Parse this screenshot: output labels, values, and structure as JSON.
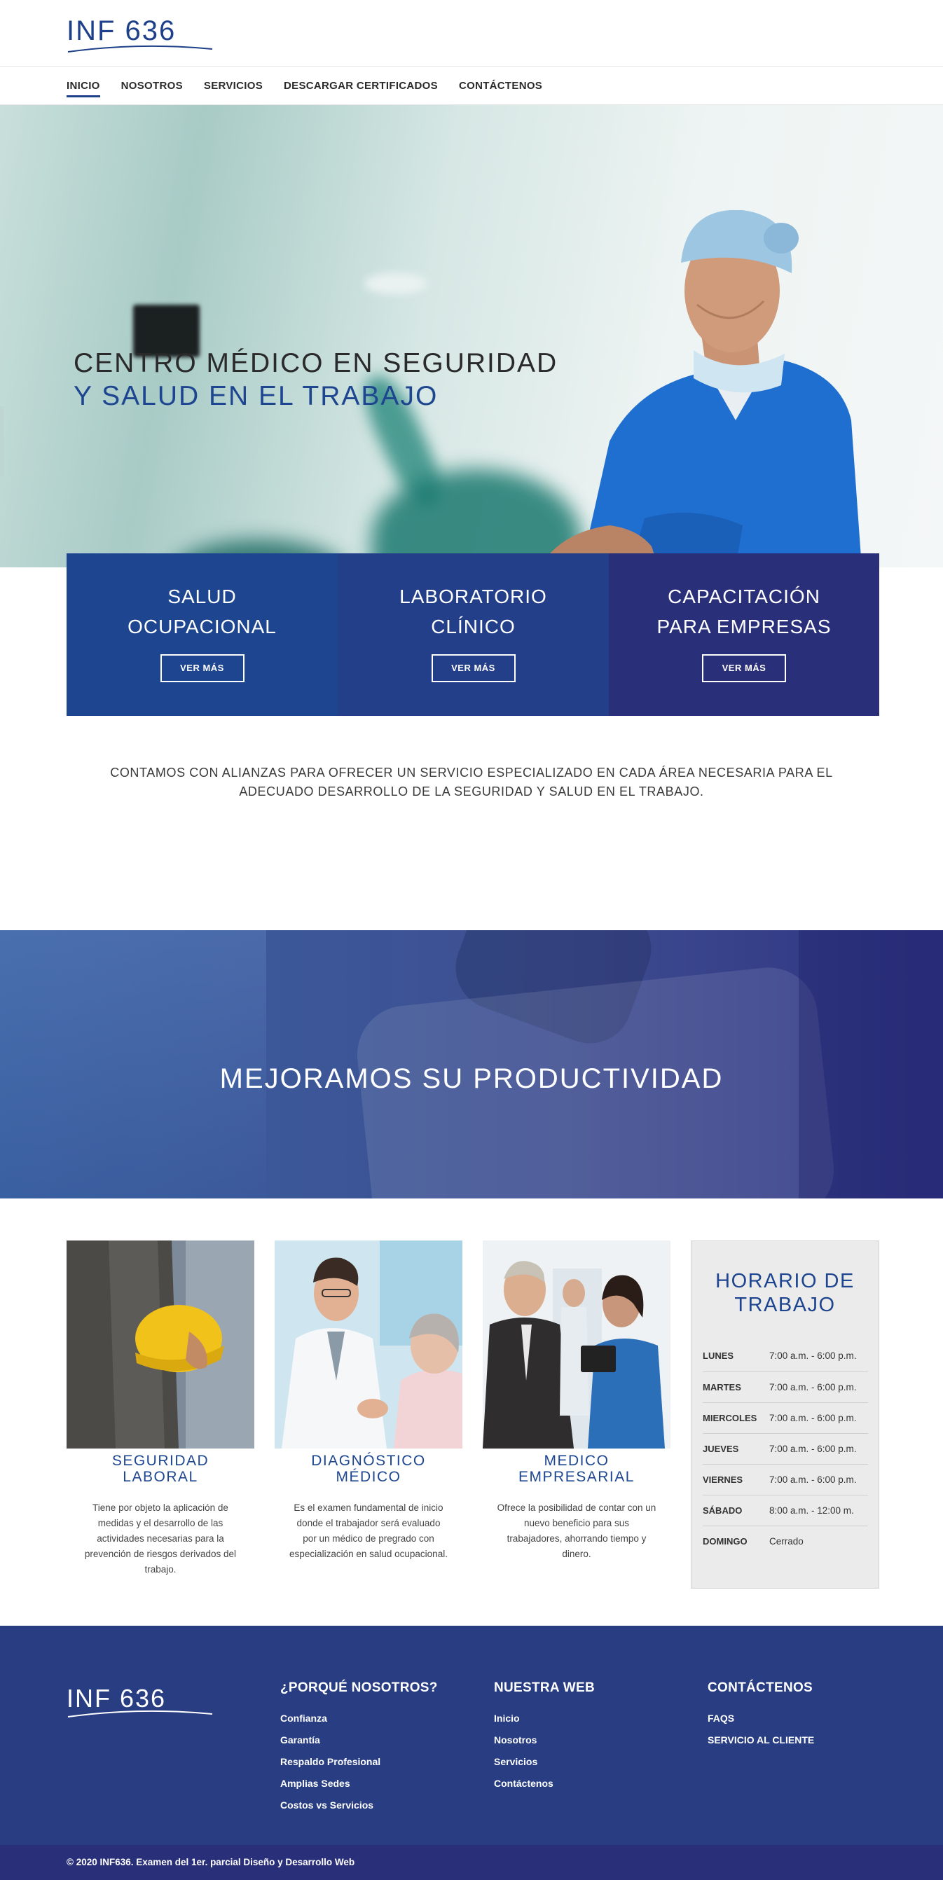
{
  "brand": {
    "logo_text": "INF 636"
  },
  "nav": {
    "items": [
      {
        "label": "INICIO",
        "active": true
      },
      {
        "label": "NOSOTROS"
      },
      {
        "label": "SERVICIOS"
      },
      {
        "label": "DESCARGAR CERTIFICADOS"
      },
      {
        "label": "CONTÁCTENOS"
      }
    ]
  },
  "hero": {
    "title_line1": "CENTRO MÉDICO EN SEGURIDAD",
    "title_line2": "Y SALUD EN EL TRABAJO"
  },
  "services": [
    {
      "title_line1": "SALUD",
      "title_line2": "OCUPACIONAL",
      "button": "VER MÁS",
      "color": "#1e4690"
    },
    {
      "title_line1": "LABORATORIO",
      "title_line2": "CLÍNICO",
      "button": "VER MÁS",
      "color": "#243f8a"
    },
    {
      "title_line1": "CAPACITACIÓN",
      "title_line2": "PARA EMPRESAS",
      "button": "VER MÁS",
      "color": "#2a2f7a"
    }
  ],
  "intro": "CONTAMOS CON ALIANZAS PARA OFRECER UN SERVICIO ESPECIALIZADO EN CADA ÁREA NECESARIA PARA EL ADECUADO DESARROLLO DE LA SEGURIDAD Y SALUD EN EL TRABAJO.",
  "banner": {
    "title": "MEJORAMOS SU PRODUCTIVIDAD"
  },
  "features": [
    {
      "title_line1": "SEGURIDAD",
      "title_line2": "LABORAL",
      "text": "Tiene por objeto la aplicación de medidas y el desarrollo de las actividades necesarias para la prevención de riesgos derivados del trabajo."
    },
    {
      "title_line1": "DIAGNÓSTICO",
      "title_line2": "MÉDICO",
      "text": "Es el examen fundamental de inicio donde el trabajador será evaluado por un médico de pregrado con especialización en salud ocupacional."
    },
    {
      "title_line1": "MEDICO",
      "title_line2": "EMPRESARIAL",
      "text": "Ofrece la posibilidad de contar con un nuevo beneficio para sus trabajadores, ahorrando tiempo y dinero."
    }
  ],
  "schedule": {
    "title_line1": "HORARIO DE",
    "title_line2": "TRABAJO",
    "rows": [
      {
        "day": "LUNES",
        "hours": "7:00 a.m. - 6:00 p.m."
      },
      {
        "day": "MARTES",
        "hours": "7:00 a.m. - 6:00 p.m."
      },
      {
        "day": "MIERCOLES",
        "hours": "7:00 a.m. - 6:00 p.m."
      },
      {
        "day": "JUEVES",
        "hours": "7:00 a.m. - 6:00 p.m."
      },
      {
        "day": "VIERNES",
        "hours": "7:00 a.m. - 6:00 p.m."
      },
      {
        "day": "SÁBADO",
        "hours": "8:00 a.m. - 12:00 m."
      },
      {
        "day": "DOMINGO",
        "hours": "Cerrado"
      }
    ]
  },
  "footer": {
    "col1": {
      "title": "¿PORQUÉ NOSOTROS?",
      "items": [
        "Confianza",
        "Garantía",
        "Respaldo Profesional",
        "Amplias Sedes",
        "Costos vs Servicios"
      ]
    },
    "col2": {
      "title": "NUESTRA WEB",
      "items": [
        "Inicio",
        "Nosotros",
        "Servicios",
        "Contáctenos"
      ]
    },
    "col3": {
      "title": "CONTÁCTENOS",
      "items": [
        "FAQS",
        "SERVICIO AL CLIENTE"
      ]
    },
    "copyright": "© 2020 INF636. Examen del 1er. parcial Diseño y Desarrollo Web"
  },
  "colors": {
    "primary": "#1e4690",
    "footer": "#283d82",
    "copyright_bar": "#2a2f7a"
  }
}
